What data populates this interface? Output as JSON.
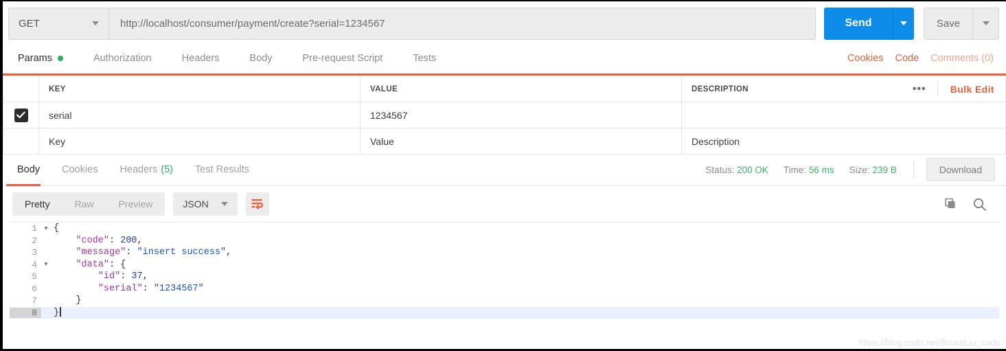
{
  "request": {
    "method": "GET",
    "url": "http://localhost/consumer/payment/create?serial=1234567",
    "send_label": "Send",
    "save_label": "Save"
  },
  "request_tabs": [
    {
      "label": "Params",
      "active": true,
      "dot": true
    },
    {
      "label": "Authorization",
      "active": false
    },
    {
      "label": "Headers",
      "active": false
    },
    {
      "label": "Body",
      "active": false
    },
    {
      "label": "Pre-request Script",
      "active": false
    },
    {
      "label": "Tests",
      "active": false
    }
  ],
  "request_tabs_right": {
    "cookies": "Cookies",
    "code": "Code",
    "comments": "Comments (0)"
  },
  "params_table": {
    "headers": [
      "KEY",
      "VALUE",
      "DESCRIPTION"
    ],
    "bulk_edit": "Bulk Edit",
    "more_dots": "•••",
    "rows": [
      {
        "checked": true,
        "key": "serial",
        "value": "1234567",
        "description": ""
      }
    ],
    "placeholder_row": {
      "key": "Key",
      "value": "Value",
      "description": "Description"
    }
  },
  "response_tabs": [
    {
      "label": "Body",
      "active": true
    },
    {
      "label": "Cookies",
      "active": false
    },
    {
      "label": "Headers",
      "active": false,
      "count": "(5)"
    },
    {
      "label": "Test Results",
      "active": false
    }
  ],
  "response_meta": {
    "status_label": "Status:",
    "status_value": "200 OK",
    "time_label": "Time:",
    "time_value": "56 ms",
    "size_label": "Size:",
    "size_value": "239 B",
    "download_label": "Download"
  },
  "body_toolbar": {
    "views": [
      {
        "label": "Pretty",
        "active": true
      },
      {
        "label": "Raw",
        "active": false
      },
      {
        "label": "Preview",
        "active": false
      }
    ],
    "format": "JSON",
    "wrap_icon": "wrap-text-icon",
    "copy_icon": "copy-icon",
    "search_icon": "search-icon"
  },
  "response_body": {
    "language": "json",
    "lines": [
      {
        "num": "1",
        "fold": true,
        "tokens": [
          {
            "t": "{",
            "c": "p"
          }
        ]
      },
      {
        "num": "2",
        "fold": false,
        "tokens": [
          {
            "t": "    ",
            "c": "p"
          },
          {
            "t": "\"code\"",
            "c": "k"
          },
          {
            "t": ": ",
            "c": "p"
          },
          {
            "t": "200",
            "c": "n"
          },
          {
            "t": ",",
            "c": "p"
          }
        ]
      },
      {
        "num": "3",
        "fold": false,
        "tokens": [
          {
            "t": "    ",
            "c": "p"
          },
          {
            "t": "\"message\"",
            "c": "k"
          },
          {
            "t": ": ",
            "c": "p"
          },
          {
            "t": "\"insert success\"",
            "c": "s"
          },
          {
            "t": ",",
            "c": "p"
          }
        ]
      },
      {
        "num": "4",
        "fold": true,
        "tokens": [
          {
            "t": "    ",
            "c": "p"
          },
          {
            "t": "\"data\"",
            "c": "k"
          },
          {
            "t": ": ",
            "c": "p"
          },
          {
            "t": "{",
            "c": "p"
          }
        ]
      },
      {
        "num": "5",
        "fold": false,
        "tokens": [
          {
            "t": "        ",
            "c": "p"
          },
          {
            "t": "\"id\"",
            "c": "k"
          },
          {
            "t": ": ",
            "c": "p"
          },
          {
            "t": "37",
            "c": "n"
          },
          {
            "t": ",",
            "c": "p"
          }
        ]
      },
      {
        "num": "6",
        "fold": false,
        "tokens": [
          {
            "t": "        ",
            "c": "p"
          },
          {
            "t": "\"serial\"",
            "c": "k"
          },
          {
            "t": ": ",
            "c": "p"
          },
          {
            "t": "\"1234567\"",
            "c": "s"
          }
        ]
      },
      {
        "num": "7",
        "fold": false,
        "tokens": [
          {
            "t": "    ",
            "c": "p"
          },
          {
            "t": "}",
            "c": "p"
          }
        ]
      },
      {
        "num": "8",
        "fold": false,
        "highlight": true,
        "cursor": true,
        "tokens": [
          {
            "t": "}",
            "c": "p"
          }
        ]
      }
    ],
    "raw_text": "{\n    \"code\": 200,\n    \"message\": \"insert success\",\n    \"data\": {\n        \"id\": 37,\n        \"serial\": \"1234567\"\n    }\n}"
  },
  "watermark": "https://blog.csdn.net/BruceLiu_code",
  "colors": {
    "accent_orange": "#e8603c",
    "send_blue": "#0d8ce8",
    "success_green": "#28b05f",
    "json_key": "#a0369b",
    "json_string": "#1a4fd6",
    "json_number": "#1f3fa8"
  }
}
